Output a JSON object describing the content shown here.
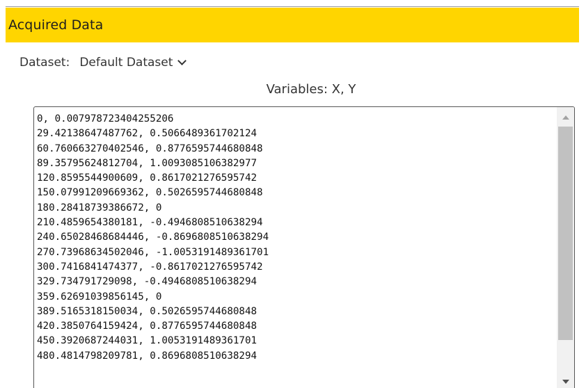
{
  "panel": {
    "title": "Acquired Data"
  },
  "dataset": {
    "label": "Dataset:",
    "selected": "Default Dataset"
  },
  "variables_label": "Variables: X, Y",
  "data_rows": [
    "0, 0.007978723404255206",
    "29.42138647487762, 0.5066489361702124",
    "60.760663270402546, 0.8776595744680848",
    "89.35795624812704, 1.0093085106382977",
    "120.8595544900609, 0.8617021276595742",
    "150.07991209669362, 0.5026595744680848",
    "180.28418739386672, 0",
    "210.4859654380181, -0.4946808510638294",
    "240.65028468684446, -0.8696808510638294",
    "270.73968634502046, -1.0053191489361701",
    "300.7416841474377, -0.8617021276595742",
    "329.734791729098, -0.4946808510638294",
    "359.62691039856145, 0",
    "389.5165318150034, 0.5026595744680848",
    "420.3850764159424, 0.8776595744680848",
    "450.3920687244031, 1.0053191489361701",
    "480.4814798209781, 0.8696808510638294"
  ]
}
